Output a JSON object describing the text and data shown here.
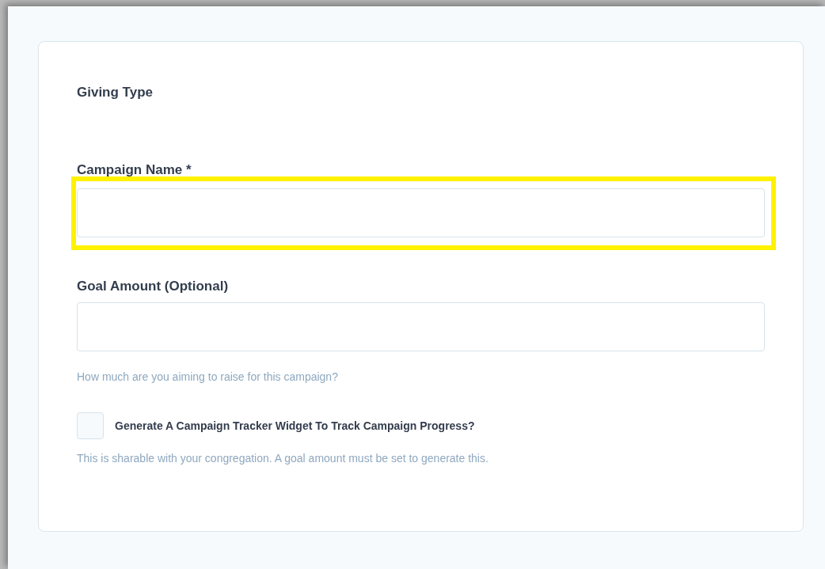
{
  "section": {
    "title": "Giving Type"
  },
  "fields": [
    {
      "label": "Campaign Name *",
      "highlighted": true
    },
    {
      "label": "Goal Amount (Optional)",
      "highlighted": false,
      "hint": "How much are you aiming to raise for this campaign?"
    }
  ],
  "tracker": {
    "label": "Generate A Campaign Tracker Widget To Track Campaign Progress?",
    "checked": false,
    "hint": "This is sharable with your congregation. A goal amount must be set to generate this."
  }
}
